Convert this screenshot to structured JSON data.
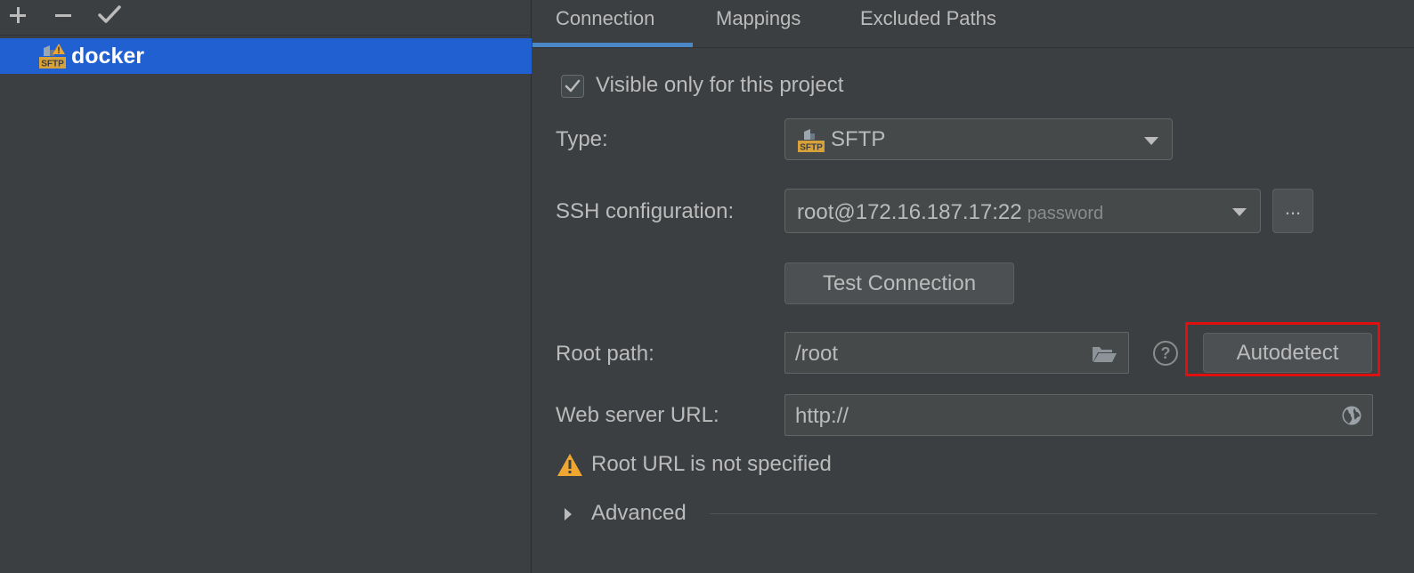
{
  "left_toolbar": {
    "add_icon": "plus-icon",
    "remove_icon": "minus-icon",
    "apply_icon": "checkmark-icon"
  },
  "servers": [
    {
      "name": "docker",
      "icon": "sftp-warning-icon",
      "selected": true
    }
  ],
  "tabs": [
    {
      "label": "Connection",
      "active": true
    },
    {
      "label": "Mappings",
      "active": false
    },
    {
      "label": "Excluded Paths",
      "active": false
    }
  ],
  "connection": {
    "visible_only_label": "Visible only for this project",
    "visible_only_checked": true,
    "type_label": "Type:",
    "type_value": "SFTP",
    "ssh_label": "SSH configuration:",
    "ssh_value": "root@172.16.187.17:22",
    "ssh_auth": "password",
    "ssh_more_label": "...",
    "test_connection_label": "Test Connection",
    "root_path_label": "Root path:",
    "root_path_value": "/root",
    "help_label": "?",
    "autodetect_label": "Autodetect",
    "web_url_label": "Web server URL:",
    "web_url_value": "http://",
    "warning_text": "Root URL is not specified",
    "advanced_label": "Advanced"
  },
  "colors": {
    "background": "#3c3f41",
    "selection": "#2060d0",
    "tab_underline": "#4a88c7",
    "highlight_box": "#e01010",
    "warning": "#f0a732",
    "sftp_icon": "#d8a23a"
  }
}
